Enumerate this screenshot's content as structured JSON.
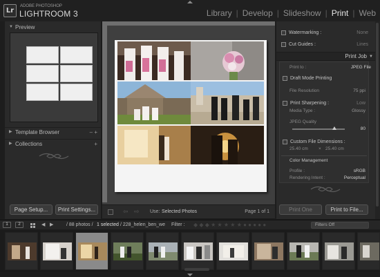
{
  "app": {
    "logo": "Lr",
    "vendor": "ADOBE PHOTOSHOP",
    "product": "LIGHTROOM 3",
    "modules": [
      "Library",
      "Develop",
      "Slideshow",
      "Print",
      "Web"
    ],
    "active_module": "Print"
  },
  "left_panel": {
    "preview_label": "Preview",
    "template_browser_label": "Template Browser",
    "template_browser_controls": "– +",
    "collections_label": "Collections",
    "collections_controls": "+",
    "page_setup_label": "Page Setup...",
    "print_settings_label": "Print Settings..."
  },
  "center": {
    "use_label": "Use:",
    "use_value": "Selected Photos",
    "page_info": "Page 1 of 1"
  },
  "right_panel": {
    "watermarking": {
      "label": "Watermarking :",
      "value": "None"
    },
    "cut_guides": {
      "label": "Cut Guides :",
      "value": "Lines"
    },
    "print_job_label": "Print Job",
    "print_to": {
      "label": "Print to :",
      "value": "JPEG File"
    },
    "draft_mode": {
      "label": "Draft Mode Printing"
    },
    "file_resolution": {
      "label": "File Resolution",
      "value": "75 ppi"
    },
    "print_sharpening": {
      "label": "Print Sharpening :",
      "value": "Low"
    },
    "media_type": {
      "label": "Media Type :",
      "value": "Glossy"
    },
    "jpeg_quality": {
      "label": "JPEG Quality",
      "value": "80",
      "fraction": 0.8
    },
    "custom_dimensions": {
      "label": "Custom File Dimensions :",
      "width": "25.40 cm",
      "x": "×",
      "height": "25.40 cm"
    },
    "color_management_label": "Color Management",
    "profile": {
      "label": "Profile :",
      "value": "sRGB"
    },
    "rendering_intent": {
      "label": "Rendering Intent :",
      "value": "Perceptual"
    },
    "print_one_label": "Print One",
    "print_to_file_label": "Print to File..."
  },
  "filmstrip_bar": {
    "view1": "1",
    "view2": "2",
    "photo_count": "/ 88 photos /",
    "selected": "1 selected",
    "file_name": "/ 228_helen_ben_we",
    "filter_label": "Filter :",
    "filters_value": "Filters Off"
  },
  "colors": {
    "accent": "#e6e6e6",
    "panel": "#2a2a2a",
    "background": "#1d1d1d"
  }
}
